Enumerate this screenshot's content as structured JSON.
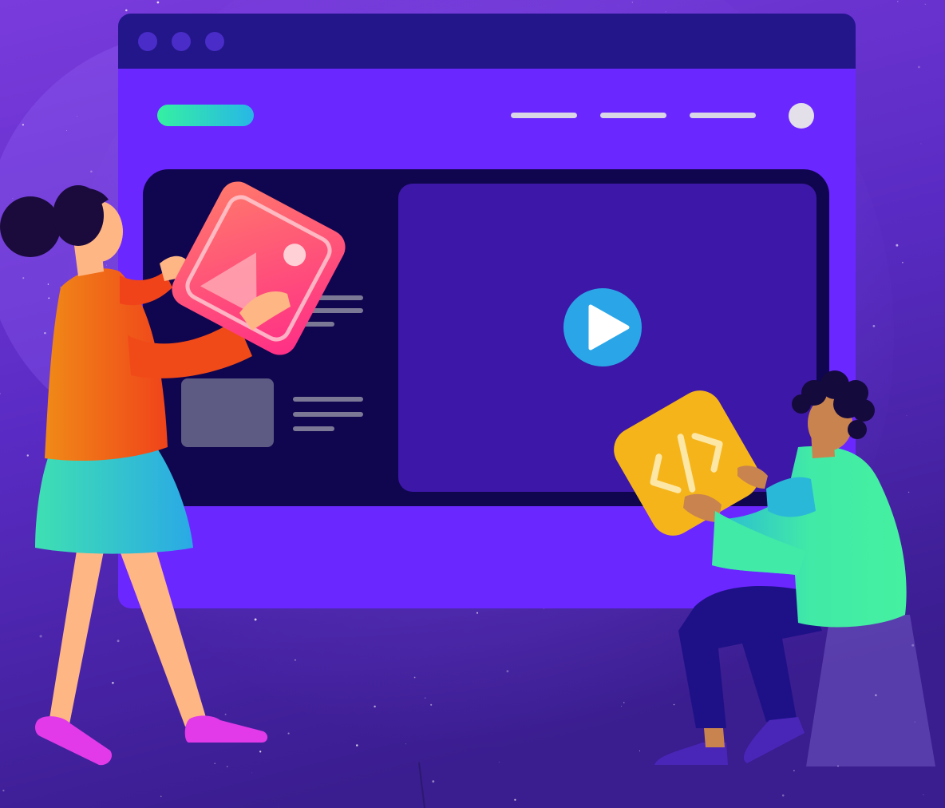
{
  "scene": {
    "colors": {
      "bg_top": "#6a2fd6",
      "bg_bottom": "#3a1d8f",
      "window_chrome": "#21168a",
      "window_body": "#6b27ff",
      "hero_panel": "#10064f",
      "video_panel": "#3d17a8",
      "play_button": "#2aa6e8",
      "image_card_from": "#ff6b6b",
      "image_card_to": "#ff2d87",
      "code_card": "#f5b51a",
      "logo_from": "#35f0a2",
      "logo_to": "#27b7e6",
      "nav_line": "#d9d6e6",
      "avatar": "#e3e0ea",
      "thumb": "#5d5a84"
    },
    "window": {
      "dots": [
        {
          "name": "window-dot-1"
        },
        {
          "name": "window-dot-2"
        },
        {
          "name": "window-dot-3"
        }
      ],
      "nav": {
        "items": [
          {
            "name": "nav-item-1"
          },
          {
            "name": "nav-item-2"
          },
          {
            "name": "nav-item-3"
          }
        ]
      },
      "video": {
        "play_icon": "play-icon"
      },
      "content_rows": [
        {
          "name": "content-row-1",
          "thumbnail": "image-icon"
        },
        {
          "name": "content-row-2",
          "thumbnail": "placeholder-thumbnail"
        }
      ]
    },
    "characters": [
      {
        "name": "woman-character",
        "holding": "image-icon-card"
      },
      {
        "name": "man-character",
        "holding": "code-icon-card"
      }
    ]
  }
}
